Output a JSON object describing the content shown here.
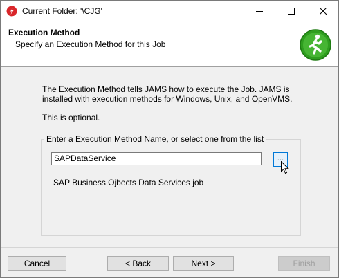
{
  "window": {
    "title": "Current Folder: '\\CJG'"
  },
  "titlebar": {
    "minimize_icon": "minimize-icon",
    "maximize_icon": "maximize-icon",
    "close_icon": "close-icon"
  },
  "header": {
    "title": "Execution Method",
    "subtitle": "Specify an Execution Method for this Job",
    "icon": "running-man-icon",
    "icon_color": "#2f9e1f"
  },
  "body": {
    "description": "The Execution Method tells JAMS how to execute the Job.  JAMS is installed with execution methods for Windows, Unix, and OpenVMS.",
    "optional_text": "This is optional.",
    "group_label": "Enter a Execution Method Name, or select one from the list",
    "method_value": "SAPDataService",
    "browse_label": "...",
    "method_description": "SAP Business Ojbects Data Services job"
  },
  "footer": {
    "cancel_label": "Cancel",
    "back_label": "< Back",
    "next_label": "Next >",
    "finish_label": "Finish"
  }
}
